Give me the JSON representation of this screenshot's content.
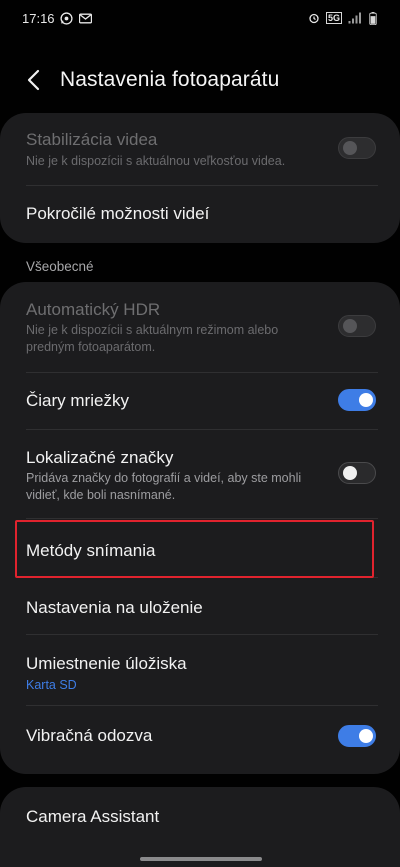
{
  "status_bar": {
    "time": "17:16",
    "network": "5G",
    "left_icons": [
      "whatsapp-icon",
      "gmail-icon"
    ],
    "right_icons": [
      "alarm-icon",
      "signal-icon",
      "battery-icon"
    ]
  },
  "header": {
    "title": "Nastavenia fotoaparátu"
  },
  "card1": {
    "stabilization": {
      "title": "Stabilizácia videa",
      "subtitle": "Nie je k dispozícii s aktuálnou veľkosťou videa.",
      "toggle": "disabled-off"
    },
    "advanced_video": {
      "title": "Pokročilé možnosti videí"
    }
  },
  "general": {
    "label": "Všeobecné",
    "auto_hdr": {
      "title": "Automatický HDR",
      "subtitle": "Nie je k dispozícii s aktuálnym režimom alebo predným fotoaparátom.",
      "toggle": "disabled-off"
    },
    "grid_lines": {
      "title": "Čiary mriežky",
      "toggle": "on"
    },
    "location_tags": {
      "title": "Lokalizačné značky",
      "subtitle": "Pridáva značky do fotografií a videí, aby ste mohli vidieť, kde boli nasnímané.",
      "toggle": "off"
    },
    "shooting_methods": {
      "title": "Metódy snímania"
    },
    "settings_to_keep": {
      "title": "Nastavenia na uloženie"
    },
    "storage_location": {
      "title": "Umiestnenie úložiska",
      "value": "Karta SD"
    },
    "vibration_feedback": {
      "title": "Vibračná odozva",
      "toggle": "on"
    }
  },
  "card3": {
    "camera_assistant": {
      "title": "Camera Assistant"
    }
  },
  "colors": {
    "accent": "#3e7de6",
    "highlight": "#e0232e",
    "card": "#1c1c1e",
    "background": "#010101"
  }
}
